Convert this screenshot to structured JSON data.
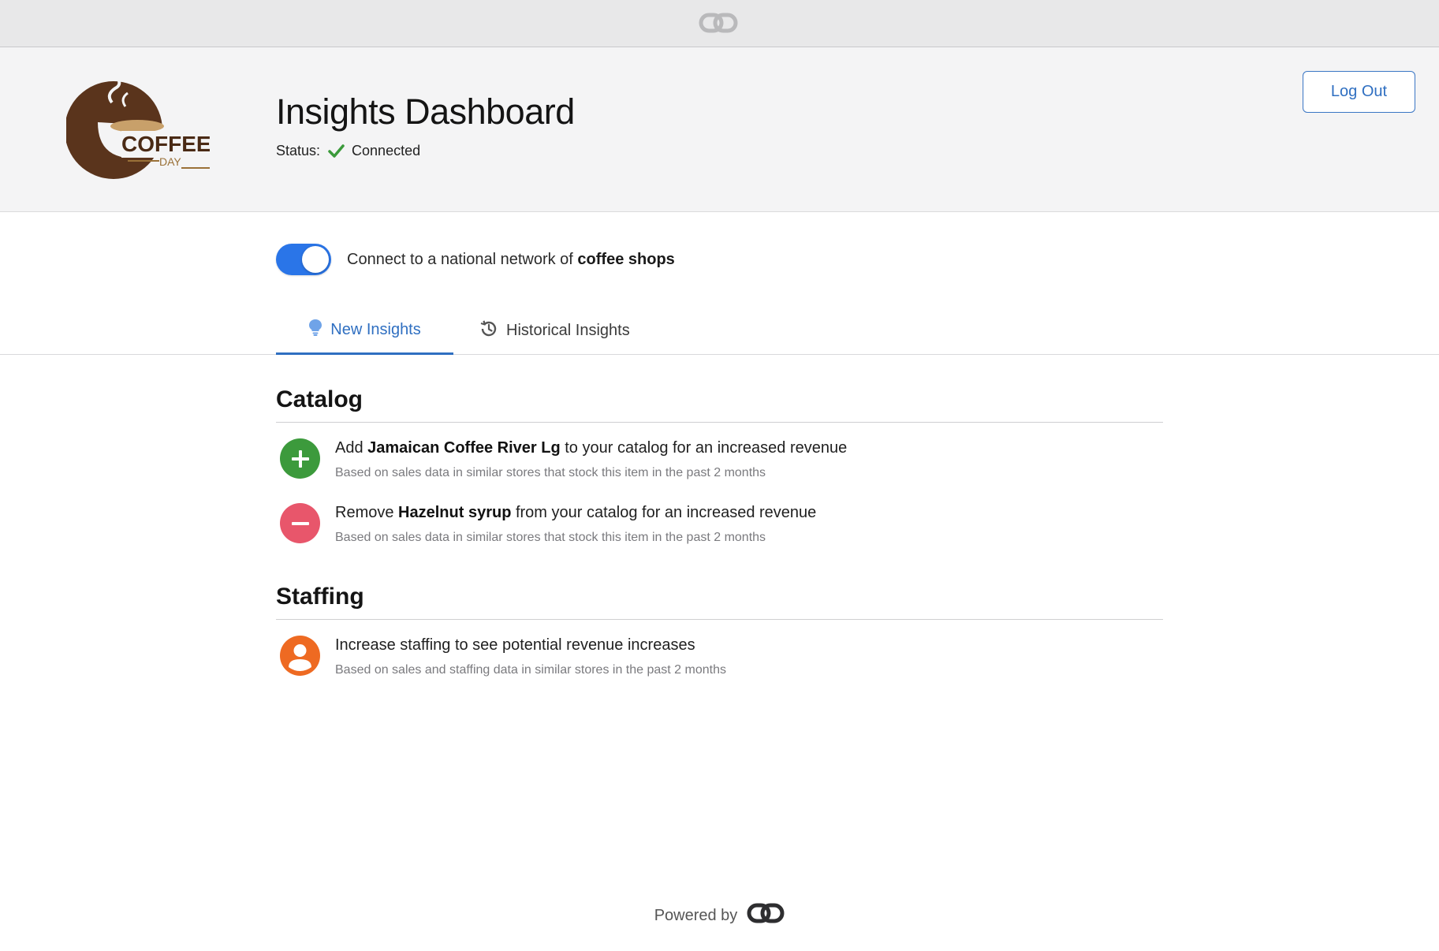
{
  "topbar": {
    "icon": "link-brand-icon"
  },
  "header": {
    "logo": {
      "brand_line1": "COFFEE",
      "brand_line2": "DAY"
    },
    "title": "Insights Dashboard",
    "status_label": "Status:",
    "status_value": "Connected",
    "status_color": "#3a9a3a",
    "logout_label": "Log Out"
  },
  "network_toggle": {
    "on": true,
    "label_prefix": "Connect to a national network of",
    "label_bold": "coffee shops",
    "color": "#2a75e8"
  },
  "tabs": [
    {
      "label": "New Insights",
      "icon": "lightbulb-icon",
      "active": true
    },
    {
      "label": "Historical Insights",
      "icon": "history-icon",
      "active": false
    }
  ],
  "sections": {
    "catalog": {
      "title": "Catalog",
      "items": [
        {
          "icon": "plus-icon",
          "color": "#3c9a3c",
          "prefix": "Add",
          "bold": "Jamaican Coffee River Lg",
          "suffix": "to your catalog for an increased revenue",
          "detail": "Based on sales data in similar stores that stock this item in the past 2 months"
        },
        {
          "icon": "minus-icon",
          "color": "#e8566b",
          "prefix": "Remove",
          "bold": "Hazelnut syrup",
          "suffix": "from your catalog for an increased revenue",
          "detail": "Based on sales data in similar stores that stock this item in the past 2 months"
        }
      ]
    },
    "staffing": {
      "title": "Staffing",
      "items": [
        {
          "icon": "person-icon",
          "color": "#ee6a22",
          "text": "Increase staffing to see potential revenue increases",
          "detail": "Based on sales and staffing data in similar stores in the past 2 months"
        }
      ]
    }
  },
  "footer": {
    "label": "Powered by",
    "icon": "link-brand-icon"
  }
}
